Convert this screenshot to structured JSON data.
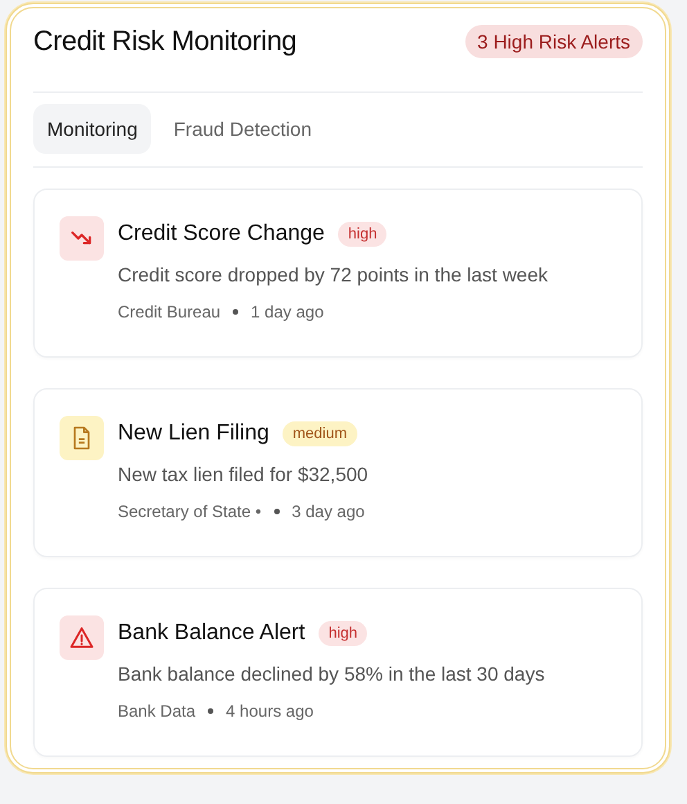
{
  "header": {
    "title": "Credit Risk Monitoring",
    "badge": "3 High Risk Alerts"
  },
  "tabs": [
    {
      "label": "Monitoring",
      "selected": true
    },
    {
      "label": "Fraud Detection",
      "selected": false
    }
  ],
  "alerts": [
    {
      "kind": "trend",
      "title": "Credit Score Change",
      "severity": "high",
      "description": "Credit score dropped by 72 points in the last week",
      "source": "Credit Bureau",
      "time": "1 day ago"
    },
    {
      "kind": "filing",
      "title": "New Lien Filing",
      "severity": "medium",
      "description": "New tax lien filed for $32,500",
      "source": "Secretary of State •",
      "time": "3 day ago"
    },
    {
      "kind": "warning",
      "title": "Bank Balance Alert",
      "severity": "high",
      "description": "Bank balance declined by 58% in the last 30 days",
      "source": "Bank Data",
      "time": "4 hours ago"
    }
  ]
}
